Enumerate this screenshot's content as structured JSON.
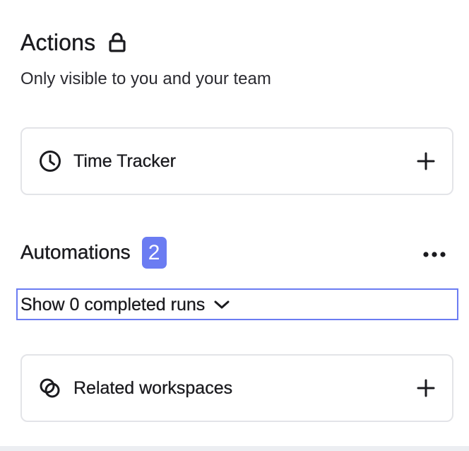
{
  "actions": {
    "title": "Actions",
    "lock_icon": "lock-icon",
    "subtitle": "Only visible to you and your team"
  },
  "time_tracker": {
    "label": "Time Tracker",
    "icon": "clock-icon",
    "action_icon": "plus-icon"
  },
  "automations": {
    "title": "Automations",
    "count": "2",
    "more_icon": "more-horizontal-icon",
    "toggle_label": "Show 0 completed runs",
    "toggle_icon": "chevron-down-icon"
  },
  "related_workspaces": {
    "label": "Related workspaces",
    "icon": "linked-circles-icon",
    "action_icon": "plus-icon"
  },
  "colors": {
    "accent": "#6b7cf2",
    "card_border": "#e3e4e8",
    "text": "#1b1b1f"
  }
}
